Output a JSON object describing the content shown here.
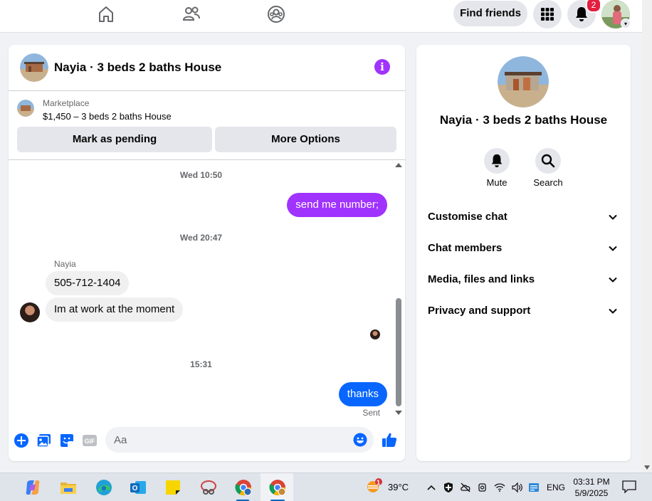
{
  "topbar": {
    "find_friends_label": "Find friends",
    "notification_count": "2"
  },
  "chat": {
    "title": "Nayia · 3 beds 2 baths House",
    "marketplace_label": "Marketplace",
    "listing": "$1,450 – 3 beds 2 baths House",
    "mark_pending_label": "Mark as pending",
    "more_options_label": "More Options",
    "messages": [
      {
        "type": "timestamp",
        "text": "Wed 10:50"
      },
      {
        "type": "outgoing",
        "text": "send me number;",
        "color": "#a033ff"
      },
      {
        "type": "timestamp",
        "text": "Wed 20:47"
      },
      {
        "type": "sender",
        "text": "Nayia"
      },
      {
        "type": "incoming",
        "text": "505-712-1404"
      },
      {
        "type": "incoming",
        "text": "Im at work at the moment"
      },
      {
        "type": "timestamp",
        "text": "15:31"
      },
      {
        "type": "outgoing",
        "text": "thanks",
        "color": "#0866ff"
      },
      {
        "type": "status",
        "text": "Sent"
      }
    ],
    "composer_placeholder": "Aa"
  },
  "profile_panel": {
    "name": "Nayia · 3 beds 2 baths House",
    "actions": [
      {
        "label": "Mute",
        "icon": "bell-icon"
      },
      {
        "label": "Search",
        "icon": "search-icon"
      }
    ],
    "sections": [
      {
        "label": "Customise chat"
      },
      {
        "label": "Chat members"
      },
      {
        "label": "Media, files and links"
      },
      {
        "label": "Privacy and support"
      }
    ]
  },
  "taskbar": {
    "weather_badge": "1",
    "temperature": "39°C",
    "language": "ENG",
    "time": "03:31 PM",
    "date": "5/9/2025"
  },
  "colors": {
    "accent_blue": "#0866ff",
    "purple": "#a033ff"
  }
}
